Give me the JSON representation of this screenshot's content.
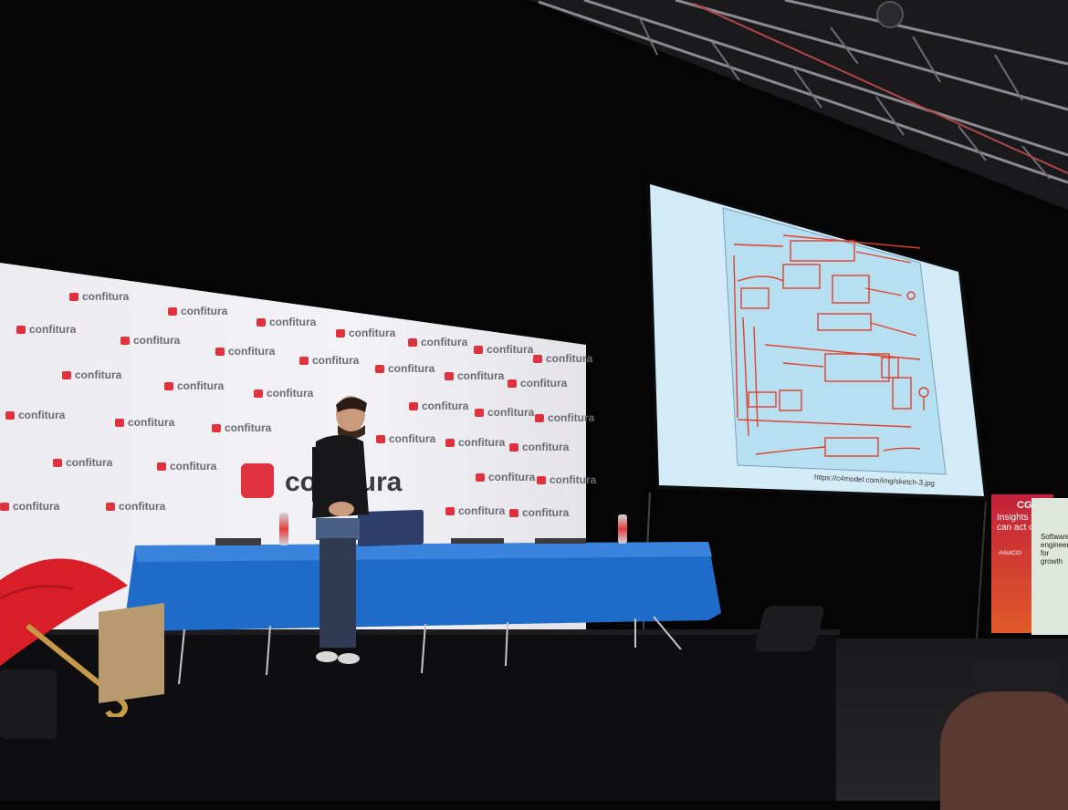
{
  "backdrop": {
    "brand": "confitura",
    "brand_big": "confitura"
  },
  "screen": {
    "caption": "https://c4model.com/img/sketch-3.jpg"
  },
  "banner": {
    "brand": "CGI",
    "headline": "Insights you can act on",
    "hashtag": "#VisitCGI"
  },
  "banner2": {
    "text": "Software engineering for growth"
  },
  "colors": {
    "brand_red": "#e0313e",
    "table_blue": "#1f6bc9",
    "screen_blue": "#cfe6f5",
    "marker_red": "#e0402a"
  }
}
